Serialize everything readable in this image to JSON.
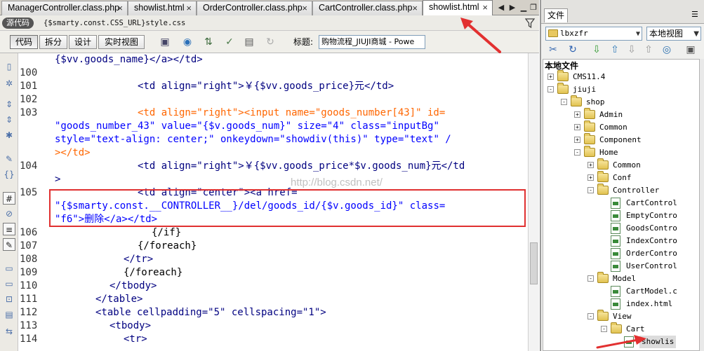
{
  "tabs": [
    {
      "label": "ManagerController.class.php",
      "active": false
    },
    {
      "label": "showlist.html",
      "active": false
    },
    {
      "label": "OrderController.class.php",
      "active": false
    },
    {
      "label": "CartController.class.php",
      "active": false
    },
    {
      "label": "showlist.html",
      "active": true
    }
  ],
  "source_bar": {
    "label": "源代码",
    "file": "{$smarty.const.CSS_URL}style.css"
  },
  "toolbar": {
    "views": [
      "代码",
      "拆分",
      "设计",
      "实时视图"
    ],
    "title_label": "标题:",
    "title_value": "购物流程_JIUJI商城 - Powe"
  },
  "code": {
    "lines": [
      {
        "num": "",
        "text": "{$vv.goods_name}</a></td>"
      },
      {
        "num": "100",
        "text": ""
      },
      {
        "num": "101",
        "text": "<td align=\"right\">￥{$vv.goods_price}元</td>"
      },
      {
        "num": "102",
        "text": ""
      },
      {
        "num": "103",
        "text": "<td align=\"right\"><input name=\"goods_number[43]\" id="
      },
      {
        "num": "",
        "text": "\"goods_number_43\" value=\"{$v.goods_num}\" size=\"4\" class=\"inputBg\""
      },
      {
        "num": "",
        "text": "style=\"text-align: center;\" onkeydown=\"showdiv(this)\" type=\"text\" /"
      },
      {
        "num": "",
        "text": "></td>"
      },
      {
        "num": "104",
        "text": "<td align=\"right\">￥{$vv.goods_price*$v.goods_num}元</td"
      },
      {
        "num": "",
        "text": ">"
      },
      {
        "num": "105",
        "text": "<td align=\"center\"><a href="
      },
      {
        "num": "",
        "text": "\"{$smarty.const.__CONTROLLER__}/del/goods_id/{$v.goods_id}\" class="
      },
      {
        "num": "",
        "text": "\"f6\">删除</a></td>"
      },
      {
        "num": "106",
        "text": "{/if}"
      },
      {
        "num": "107",
        "text": "{/foreach}"
      },
      {
        "num": "108",
        "text": "</tr>"
      },
      {
        "num": "109",
        "text": "{/foreach}"
      },
      {
        "num": "110",
        "text": "</tbody>"
      },
      {
        "num": "111",
        "text": "</table>"
      },
      {
        "num": "112",
        "text": "<table cellpadding=\"5\" cellspacing=\"1\">"
      },
      {
        "num": "113",
        "text": "<tbody>"
      },
      {
        "num": "114",
        "text": "<tr>"
      }
    ]
  },
  "watermark": "http://blog.csdn.net/",
  "files_panel": {
    "tab_label": "文件",
    "site": "lbxzfr",
    "view": "本地视图",
    "tree_title": "本地文件",
    "tree": [
      {
        "label": "CMS11.4",
        "level": 1,
        "type": "folder",
        "expander": "+"
      },
      {
        "label": "jiuji",
        "level": 1,
        "type": "folder",
        "expander": "-"
      },
      {
        "label": "shop",
        "level": 2,
        "type": "folder",
        "expander": "-"
      },
      {
        "label": "Admin",
        "level": 3,
        "type": "folder",
        "expander": "+"
      },
      {
        "label": "Common",
        "level": 3,
        "type": "folder",
        "expander": "+"
      },
      {
        "label": "Component",
        "level": 3,
        "type": "folder",
        "expander": "+"
      },
      {
        "label": "Home",
        "level": 3,
        "type": "folder",
        "expander": "-"
      },
      {
        "label": "Common",
        "level": 4,
        "type": "folder",
        "expander": "+"
      },
      {
        "label": "Conf",
        "level": 4,
        "type": "folder",
        "expander": "+"
      },
      {
        "label": "Controller",
        "level": 4,
        "type": "folder",
        "expander": "-"
      },
      {
        "label": "CartControl",
        "level": 5,
        "type": "file",
        "expander": ""
      },
      {
        "label": "EmptyContro",
        "level": 5,
        "type": "file",
        "expander": ""
      },
      {
        "label": "GoodsContro",
        "level": 5,
        "type": "file",
        "expander": ""
      },
      {
        "label": "IndexContro",
        "level": 5,
        "type": "file",
        "expander": ""
      },
      {
        "label": "OrderContro",
        "level": 5,
        "type": "file",
        "expander": ""
      },
      {
        "label": "UserControl",
        "level": 5,
        "type": "file",
        "expander": ""
      },
      {
        "label": "Model",
        "level": 4,
        "type": "folder",
        "expander": "-"
      },
      {
        "label": "CartModel.c",
        "level": 5,
        "type": "file",
        "expander": ""
      },
      {
        "label": "index.html",
        "level": 5,
        "type": "file",
        "expander": ""
      },
      {
        "label": "View",
        "level": 4,
        "type": "folder",
        "expander": "-"
      },
      {
        "label": "Cart",
        "level": 5,
        "type": "folder",
        "expander": "-"
      },
      {
        "label": "showlis",
        "level": 6,
        "type": "file",
        "expander": "",
        "selected": true
      }
    ]
  },
  "colors": {
    "highlight_box": "#e03030",
    "tag": "#000080",
    "attr_value": "#0000ff",
    "form_tag": "#ff6600"
  }
}
